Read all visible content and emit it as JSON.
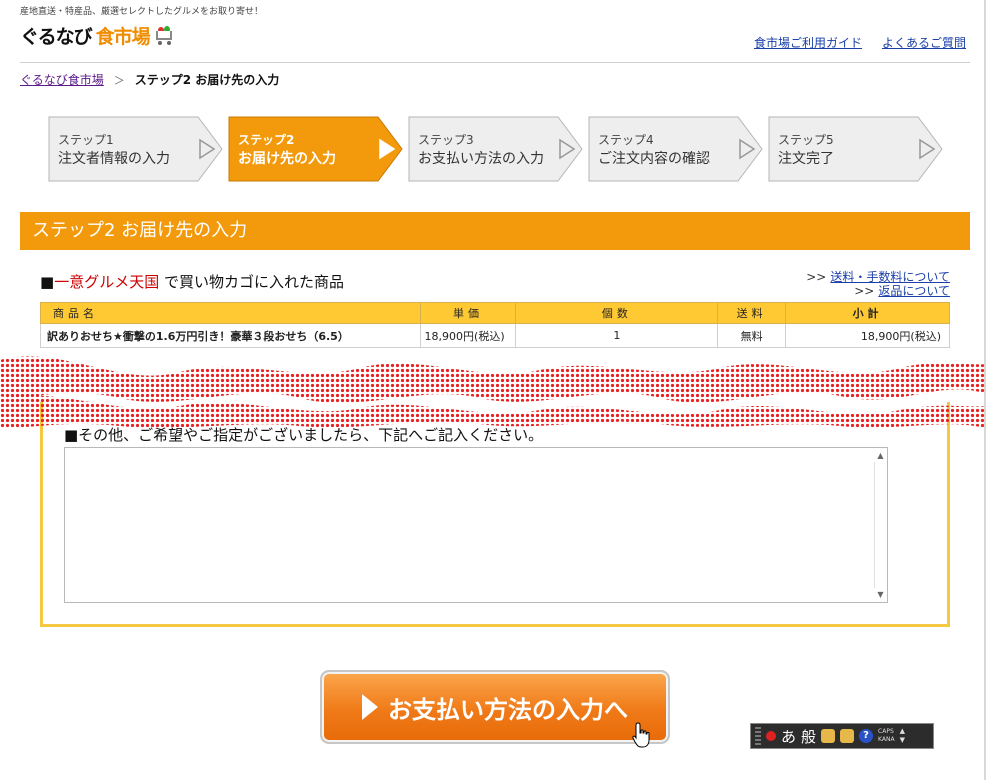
{
  "header": {
    "tagline": "産地直送・特産品、厳選セレクトしたグルメをお取り寄せ！",
    "logo_main": "ぐるなび",
    "logo_sub": "食市場",
    "links": [
      "食市場ご利用ガイド",
      "よくあるご質問"
    ]
  },
  "breadcrumb": {
    "home": "ぐるなび食市場",
    "separator": "＞",
    "current": "ステップ2 お届け先の入力"
  },
  "steps": [
    {
      "num": "ステップ1",
      "label": "注文者情報の入力",
      "active": false
    },
    {
      "num": "ステップ2",
      "label": "お届け先の入力",
      "active": true
    },
    {
      "num": "ステップ3",
      "label": "お支払い方法の入力",
      "active": false
    },
    {
      "num": "ステップ4",
      "label": "ご注文内容の確認",
      "active": false
    },
    {
      "num": "ステップ5",
      "label": "注文完了",
      "active": false
    }
  ],
  "section_title": "ステップ2 お届け先の入力",
  "cart": {
    "mark": "■",
    "store": "一意グルメ天国",
    "suffix": "で買い物カゴに入れた商品",
    "link_shipping": "送料・手数料について",
    "link_return": "返品について",
    "link_prefix": ">>",
    "headers": [
      "商品名",
      "単価",
      "個数",
      "送料",
      "小計"
    ],
    "row": {
      "name": "訳ありおせち★衝撃の1.6万円引き！豪華３段おせち（6.5）",
      "price": "18,900円(税込)",
      "qty": "1",
      "shipping": "無料",
      "subtotal": "18,900円(税込)"
    }
  },
  "notes": {
    "label": "■その他、ご希望やご指定がございましたら、下記へご記入ください。",
    "value": ""
  },
  "cta_label": "お支払い方法の入力へ",
  "ime": {
    "mode": "あ",
    "mode2": "般",
    "caps": "CAPS",
    "kana": "KANA"
  },
  "colors": {
    "brand_orange": "#f39a0c",
    "table_header": "#ffc933",
    "notes_border": "#f5c842",
    "halftone_red": "#e82020"
  }
}
